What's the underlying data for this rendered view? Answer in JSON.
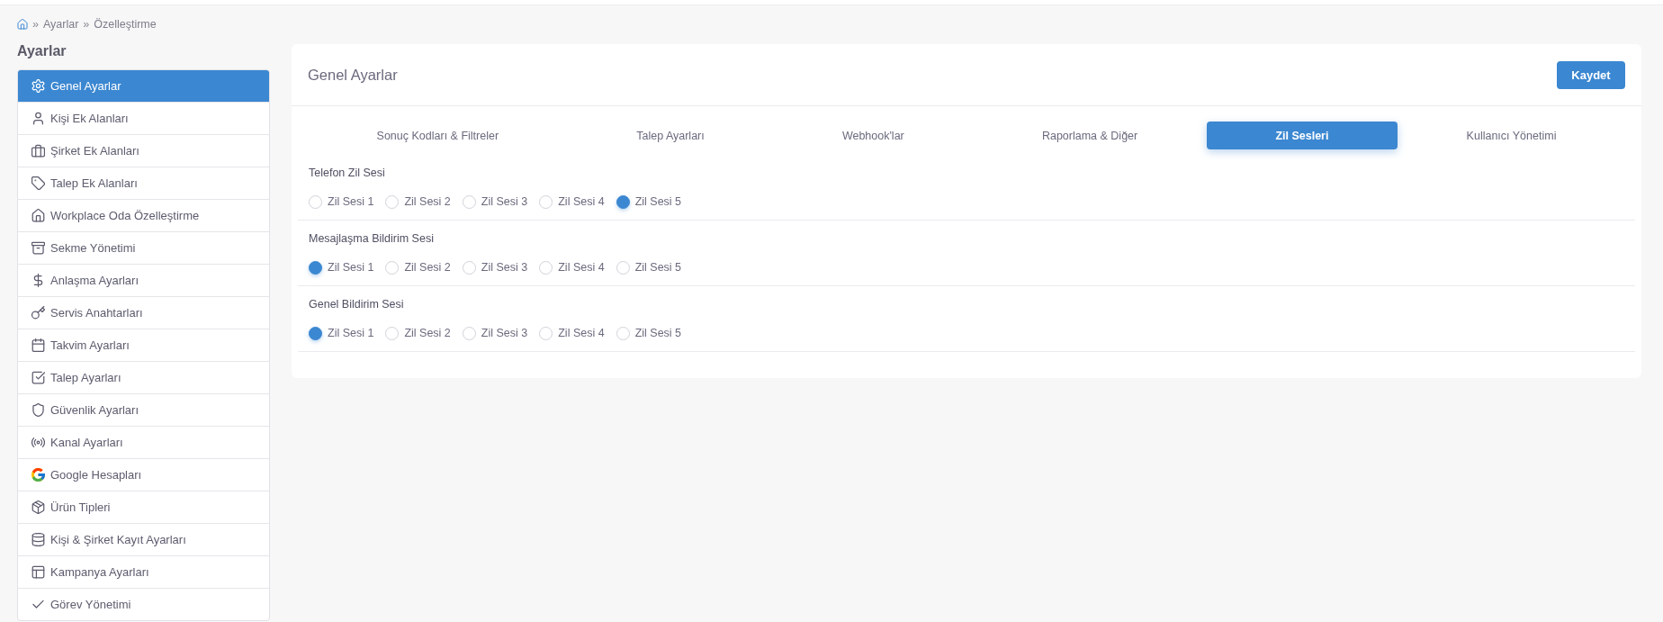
{
  "breadcrumb": [
    {
      "separator": "»",
      "label": "Ayarlar"
    },
    {
      "separator": "»",
      "label": "Özelleştirme"
    }
  ],
  "sidebar": {
    "title": "Ayarlar",
    "items": [
      {
        "label": "Genel Ayarlar",
        "selected": true
      },
      {
        "label": "Kişi Ek Alanları",
        "selected": false
      },
      {
        "label": "Şirket Ek Alanları",
        "selected": false
      },
      {
        "label": "Talep Ek Alanları",
        "selected": false
      },
      {
        "label": "Workplace Oda Özelleştirme",
        "selected": false
      },
      {
        "label": "Sekme Yönetimi",
        "selected": false
      },
      {
        "label": "Anlaşma Ayarları",
        "selected": false
      },
      {
        "label": "Servis Anahtarları",
        "selected": false
      },
      {
        "label": "Takvim Ayarları",
        "selected": false
      },
      {
        "label": "Talep Ayarları",
        "selected": false
      },
      {
        "label": "Güvenlik Ayarları",
        "selected": false
      },
      {
        "label": "Kanal Ayarları",
        "selected": false
      },
      {
        "label": "Google Hesapları",
        "selected": false
      },
      {
        "label": "Ürün Tipleri",
        "selected": false
      },
      {
        "label": "Kişi & Şirket Kayıt Ayarları",
        "selected": false
      },
      {
        "label": "Kampanya Ayarları",
        "selected": false
      },
      {
        "label": "Görev Yönetimi",
        "selected": false
      }
    ]
  },
  "panel": {
    "title": "Genel Ayarlar",
    "save_button": "Kaydet",
    "tabs": [
      {
        "label": "Sonuç Kodları & Filtreler",
        "selected": false
      },
      {
        "label": "Talep Ayarları",
        "selected": false
      },
      {
        "label": "Webhook'lar",
        "selected": false
      },
      {
        "label": "Raporlama & Diğer",
        "selected": false
      },
      {
        "label": "Zil Sesleri",
        "selected": true
      },
      {
        "label": "Kullanıcı Yönetimi",
        "selected": false
      }
    ],
    "sound_groups": [
      {
        "label": "Telefon Zil Sesi",
        "options": [
          {
            "label": "Zil Sesi 1",
            "selected": false
          },
          {
            "label": "Zil Sesi 2",
            "selected": false
          },
          {
            "label": "Zil Sesi 3",
            "selected": false
          },
          {
            "label": "Zil Sesi 4",
            "selected": false
          },
          {
            "label": "Zil Sesi 5",
            "selected": true
          }
        ]
      },
      {
        "label": "Mesajlaşma Bildirim Sesi",
        "options": [
          {
            "label": "Zil Sesi 1",
            "selected": true
          },
          {
            "label": "Zil Sesi 2",
            "selected": false
          },
          {
            "label": "Zil Sesi 3",
            "selected": false
          },
          {
            "label": "Zil Sesi 4",
            "selected": false
          },
          {
            "label": "Zil Sesi 5",
            "selected": false
          }
        ]
      },
      {
        "label": "Genel Bildirim Sesi",
        "options": [
          {
            "label": "Zil Sesi 1",
            "selected": true
          },
          {
            "label": "Zil Sesi 2",
            "selected": false
          },
          {
            "label": "Zil Sesi 3",
            "selected": false
          },
          {
            "label": "Zil Sesi 4",
            "selected": false
          },
          {
            "label": "Zil Sesi 5",
            "selected": false
          }
        ]
      }
    ]
  }
}
